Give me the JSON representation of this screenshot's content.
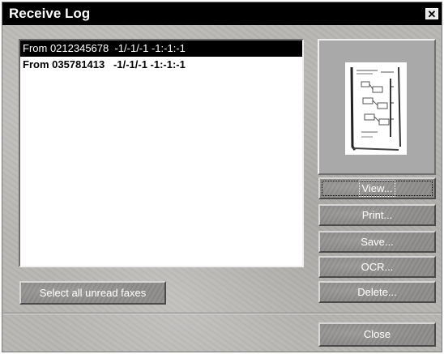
{
  "window": {
    "title": "Receive Log",
    "close_glyph": "✕"
  },
  "log": {
    "entries": [
      {
        "text": "From 0212345678  -1/-1/-1 -1:-1:-1",
        "state": "selected"
      },
      {
        "text": "From 035781413   -1/-1/-1 -1:-1:-1",
        "state": "unread"
      }
    ]
  },
  "preview": {
    "icon": "fax-page-thumbnail"
  },
  "buttons": {
    "view": "View...",
    "print": "Print...",
    "save": "Save...",
    "ocr": "OCR...",
    "delete": "Delete...",
    "select_all": "Select all unread faxes",
    "close": "Close"
  },
  "colors": {
    "titlebar": "#000000",
    "selection": "#000000",
    "button_face": "#8f8d8b"
  }
}
